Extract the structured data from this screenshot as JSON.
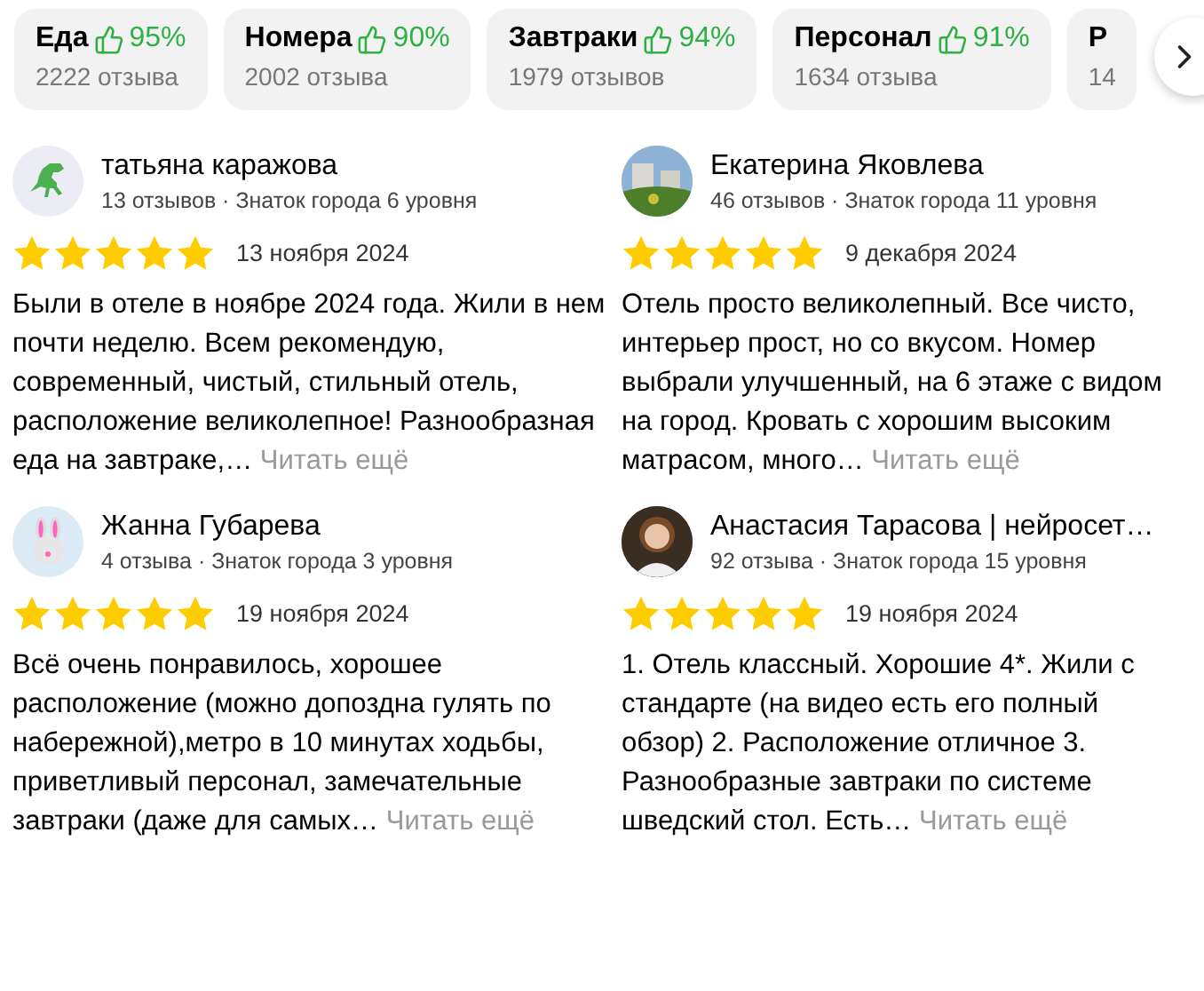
{
  "categories": [
    {
      "label": "Еда",
      "percent": "95%",
      "count": "2222 отзыва"
    },
    {
      "label": "Номера",
      "percent": "90%",
      "count": "2002 отзыва"
    },
    {
      "label": "Завтраки",
      "percent": "94%",
      "count": "1979 отзывов"
    },
    {
      "label": "Персонал",
      "percent": "91%",
      "count": "1634 отзыва"
    },
    {
      "label": "Р",
      "count": "14"
    }
  ],
  "reviews": [
    {
      "name": "татьяна каражова",
      "meta": "13 отзывов · Знаток города 6 уровня",
      "avatar": {
        "kind": "dinosaur"
      },
      "stars": 5,
      "date": "13 ноября 2024",
      "text": "Были в отеле в ноябре 2024 года. Жили в нем почти неделю. Всем рекомендую, современный, чистый, стильный отель, расположение великолепное! Разнообразная еда на завтраке,…",
      "more": "Читать ещё"
    },
    {
      "name": "Екатерина Яковлева",
      "meta": "46 отзывов · Знаток города 11 уровня",
      "stars": 5,
      "date": "9 декабря 2024",
      "text": "Отель просто великолепный. Все чисто, интерьер прост, но со вкусом. Номер выбрали улучшенный, на 6 этаже с видом на город. Кровать с хорошим высоким матрасом, много…",
      "more": "Читать ещё"
    },
    {
      "name": "Жанна Губарева",
      "meta": "4 отзыва · Знаток города 3 уровня",
      "avatar": {
        "kind": "rabbit"
      },
      "stars": 5,
      "date": "19 ноября 2024",
      "text": "Всё очень понравилось, хорошее расположение (можно допоздна гулять по набережной),метро в 10 минутах ходьбы, приветливый персонал, замечательные завтраки (даже для самых…",
      "more": "Читать ещё"
    },
    {
      "name": "Анастасия Тарасова | нейросет…",
      "meta": "92 отзыва · Знаток города 15 уровня",
      "avatar": {
        "kind": "portrait"
      },
      "stars": 5,
      "date": "19 ноября 2024",
      "text": "1. Отель классный. Хорошие 4*. Жили с стандарте (на видео есть его полный обзор) 2. Расположение отличное 3. Разнообразные завтраки по системе шведский стол. Есть…",
      "more": "Читать ещё"
    }
  ]
}
